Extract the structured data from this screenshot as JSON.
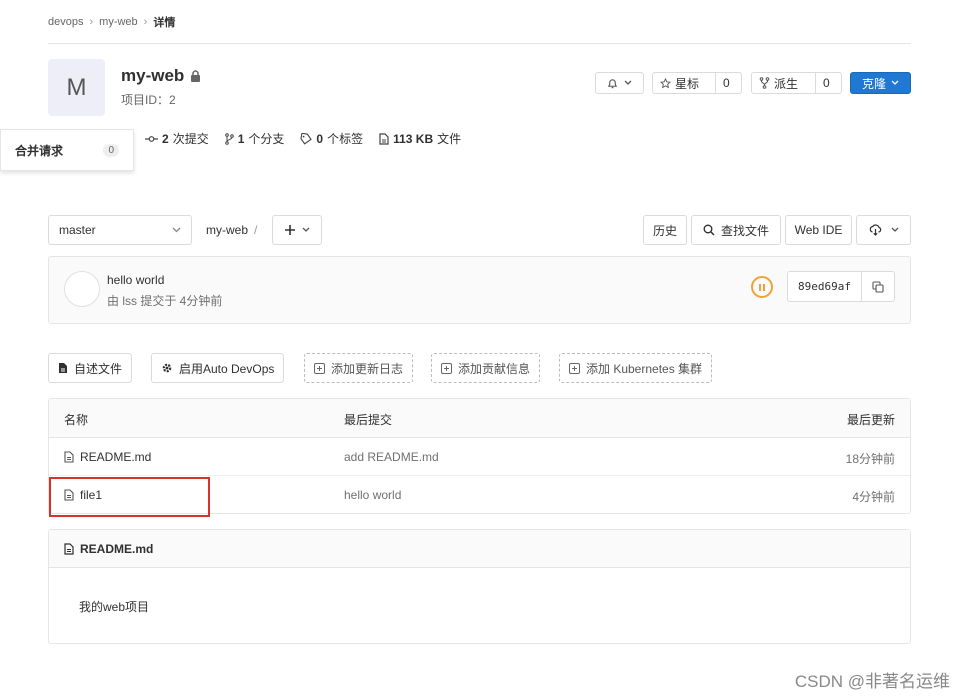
{
  "breadcrumb": {
    "group": "devops",
    "project": "my-web",
    "current": "详情"
  },
  "project": {
    "avatar_letter": "M",
    "name": "my-web",
    "id_label": "项目ID：2"
  },
  "actions": {
    "star_label": "星标",
    "star_count": "0",
    "fork_label": "派生",
    "fork_count": "0",
    "clone_label": "克隆"
  },
  "stats": {
    "commits_num": "2",
    "commits_label": "次提交",
    "branches_num": "1",
    "branches_label": "个分支",
    "tags_num": "0",
    "tags_label": "个标签",
    "size_num": "113 KB",
    "size_label": "文件"
  },
  "merge_requests": {
    "label": "合并请求",
    "count": "0"
  },
  "repo_nav": {
    "branch": "master",
    "path": "my-web",
    "slash": "/",
    "history": "历史",
    "find_file": "查找文件",
    "web_ide": "Web IDE"
  },
  "last_commit": {
    "title": "hello world",
    "meta": "由 lss 提交于 4分钟前",
    "sha": "89ed69af"
  },
  "quick_actions": [
    "自述文件",
    "启用Auto DevOps",
    "添加更新日志",
    "添加贡献信息",
    "添加 Kubernetes 集群"
  ],
  "file_table": {
    "headers": {
      "name": "名称",
      "commit": "最后提交",
      "updated": "最后更新"
    },
    "rows": [
      {
        "name": "README.md",
        "commit": "add README.md",
        "updated": "18分钟前"
      },
      {
        "name": "file1",
        "commit": "hello world",
        "updated": "4分钟前"
      }
    ]
  },
  "readme": {
    "title": "README.md",
    "content": "我的web项目"
  },
  "watermark": "CSDN @非著名运维",
  "colors": {
    "primary": "#1f78d1",
    "highlight": "#d9322b",
    "pipeline": "#f0a238"
  }
}
